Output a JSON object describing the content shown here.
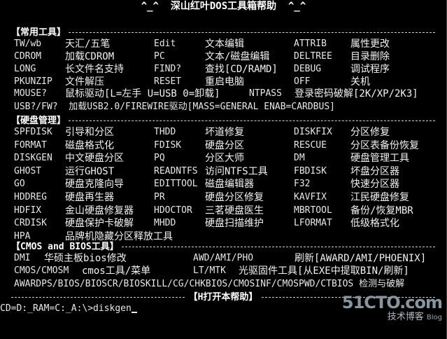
{
  "title": "^_^  深山红叶DOS工具箱帮助  ^_^",
  "sections": {
    "common": "【常用工具】",
    "disk": "【硬盘管理】",
    "cmos": "【CMOS and BIOS工具】"
  },
  "common_rows": [
    [
      "TW/wb",
      "天汇/五笔",
      "Edit",
      "文本编辑",
      "ATTRIB",
      "属性更改"
    ],
    [
      "CDROM",
      "加载CDROM",
      "PC",
      "文本/磁盘编辑",
      "DELTREE",
      "目录删除"
    ],
    [
      "LONG",
      "长文件名支持",
      "FIND?",
      "查找[CD/RAMD]",
      "DEBUG",
      "调试程序"
    ],
    [
      "PKUNZIP",
      "文件解压",
      "RESET",
      "重启电脑",
      "OFF",
      "关机"
    ]
  ],
  "common_mouse": {
    "cmd": "MOUSE?",
    "desc": "鼠标驱动[L=左手 U=USB 0=卸载]",
    "cmd2": "NTPASS",
    "desc2": "登录密码破解[2K/XP/2K3]"
  },
  "common_usb": "USB?/FW?  加载USB2.0/FIREWIRE驱动[MASS=GENERAL ENAB=CARDBUS]",
  "disk_rows": [
    [
      "SPFDISK",
      "引导和分区",
      "THDD",
      "坏道修复",
      "DISKFIX",
      "分区修复"
    ],
    [
      "FORMAT",
      "磁盘格式化",
      "FDISK",
      "硬盘分区",
      "RESCUE",
      "分区表备份恢复"
    ],
    [
      "DISKGEN",
      "中文硬盘分区",
      "PQ",
      "分区大师",
      "DM",
      "硬盘管理工具"
    ],
    [
      "GHOST",
      "运行GHOST",
      "READNTFS",
      "访问NTFS工具",
      "FBDISK",
      "坏盘分区器"
    ],
    [
      "GO",
      "硬盘克隆向导",
      "EDITTOOL",
      "磁盘编辑器",
      "F32",
      "快速分区器"
    ],
    [
      "HDDREG",
      "硬盘再生器",
      "PR",
      "硬盘分区修复",
      "KAVFIX",
      "江民硬盘修复"
    ],
    [
      "HDFIX",
      "金山硬盘修复器",
      "HDOCTOR",
      "三茗硬盘医生",
      "MBRTOOL",
      "备份/恢复MBR"
    ],
    [
      "CRDISK",
      "硬盘保护卡破解",
      "MHDD",
      "硬盘扫描维护",
      "LFORMAT",
      "低级格式化"
    ],
    [
      "HPA",
      "品牌机隐藏分区释放工具",
      "",
      "",
      "",
      ""
    ]
  ],
  "cmos_rows": [
    [
      "DMI",
      "华硕主板bios修改",
      "AWD/AMI/PHO",
      "刷新[AWARD/AMI/PHOENIX]"
    ],
    [
      "CMOS/CMOSM",
      "cmos工具/菜单",
      "LT/MTK",
      "光驱固件工具[从EXE中提取BIN/刷新]"
    ]
  ],
  "cmos_last": "AWARDPS/BIOS/BIOSCR/BIOSKILL/CG/CHKBIOS/CMOSINF/CMOSPWD/CTBIOS 检测与破解",
  "help_label": "【H打开本帮助】",
  "prompt": "CD=D:_RAM=C:_A:\\>diskgen",
  "watermark": {
    "site": "51CTO.com",
    "sub": "技术博客",
    "blog": "Blog"
  }
}
